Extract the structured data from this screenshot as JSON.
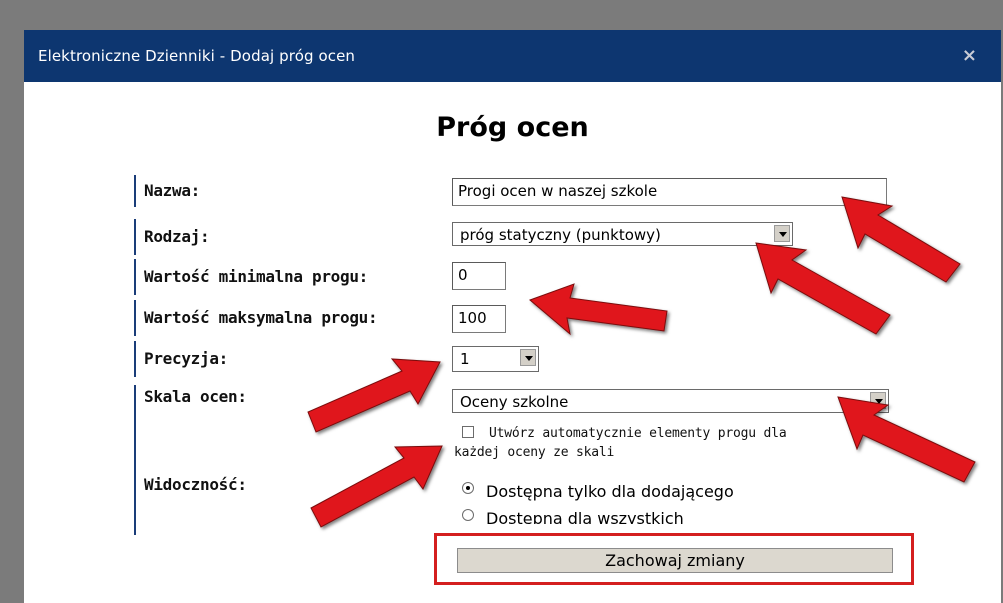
{
  "window": {
    "title": "Elektroniczne Dzienniki - Dodaj próg ocen",
    "close_glyph": "×"
  },
  "form": {
    "heading": "Próg ocen",
    "nazwa": {
      "label": "Nazwa:",
      "value": "Progi ocen w naszej szkole"
    },
    "rodzaj": {
      "label": "Rodzaj:",
      "value": "próg statyczny (punktowy)"
    },
    "wartosc_min": {
      "label": "Wartość minimalna progu:",
      "value": "0"
    },
    "wartosc_max": {
      "label": "Wartość maksymalna progu:",
      "value": "100"
    },
    "precyzja": {
      "label": "Precyzja:",
      "value": "1"
    },
    "skala": {
      "label": "Skala ocen:",
      "value": "Oceny szkolne",
      "checkbox_label_line1": "Utwórz automatycznie elementy progu dla",
      "checkbox_label_line2": "każdej oceny ze skali",
      "checkbox_checked": false
    },
    "widocznosc": {
      "label": "Widoczność:",
      "options": [
        {
          "label": "Dostępna tylko dla dodającego",
          "checked": true
        },
        {
          "label": "Dostępna dla wszystkich",
          "checked": false
        }
      ]
    },
    "save_label": "Zachowaj zmiany"
  },
  "colors": {
    "titlebar": "#0d3670",
    "annotation_arrow": "#e0161b",
    "highlight_box": "#d41f1f"
  }
}
